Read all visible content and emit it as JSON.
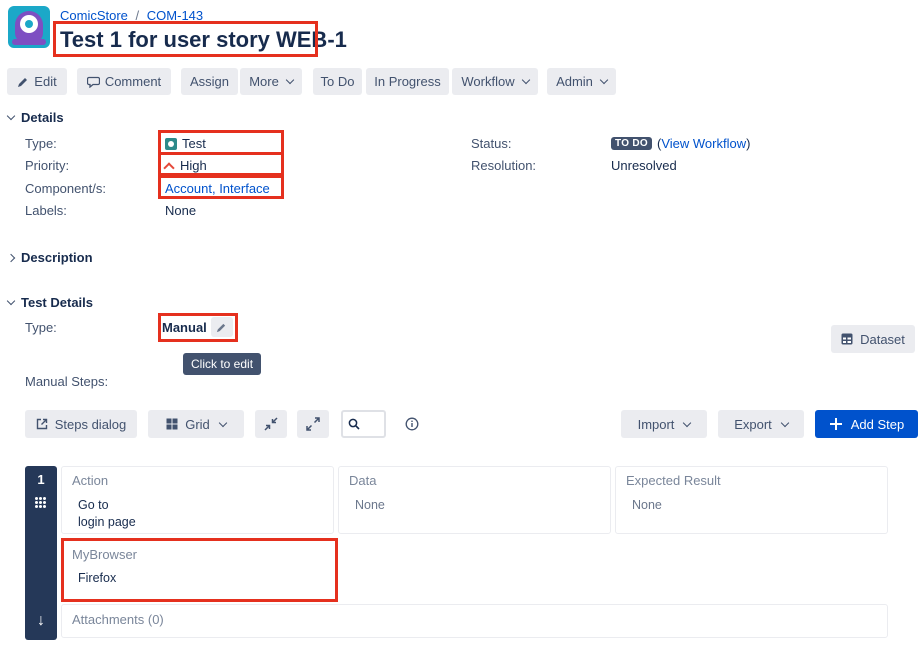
{
  "breadcrumb": {
    "project": "ComicStore",
    "separator": "/",
    "issue_key": "COM-143"
  },
  "issue": {
    "title": "Test 1 for user story WEB-1"
  },
  "toolbar": {
    "edit": "Edit",
    "comment": "Comment",
    "assign": "Assign",
    "more": "More",
    "todo": "To Do",
    "in_progress": "In Progress",
    "workflow": "Workflow",
    "admin": "Admin"
  },
  "details": {
    "heading": "Details",
    "type_label": "Type:",
    "type_value": "Test",
    "priority_label": "Priority:",
    "priority_value": "High",
    "components_label": "Component/s:",
    "components_value": "Account, Interface",
    "labels_label": "Labels:",
    "labels_value": "None",
    "status_label": "Status:",
    "status_badge": "TO DO",
    "status_link_open": "(",
    "status_link": "View Workflow",
    "status_link_close": ")",
    "resolution_label": "Resolution:",
    "resolution_value": "Unresolved"
  },
  "description": {
    "heading": "Description"
  },
  "test_details": {
    "heading": "Test Details",
    "type_label": "Type:",
    "type_value": "Manual",
    "tooltip": "Click to edit",
    "dataset_button": "Dataset",
    "manual_steps_label": "Manual Steps:"
  },
  "steps_toolbar": {
    "steps_dialog": "Steps dialog",
    "grid": "Grid",
    "import": "Import",
    "export": "Export",
    "add_step": "Add Step"
  },
  "steps": [
    {
      "number": "1",
      "action_header": "Action",
      "action_line1": "Go to",
      "action_line2": "login page",
      "data_header": "Data",
      "data_value": "None",
      "expected_header": "Expected Result",
      "expected_value": "None",
      "custom_header": "MyBrowser",
      "custom_value": "Firefox",
      "attachments": "Attachments (0)"
    }
  ],
  "colors": {
    "accent": "#0052cc",
    "highlight": "#e5301e",
    "rail": "#253858"
  }
}
